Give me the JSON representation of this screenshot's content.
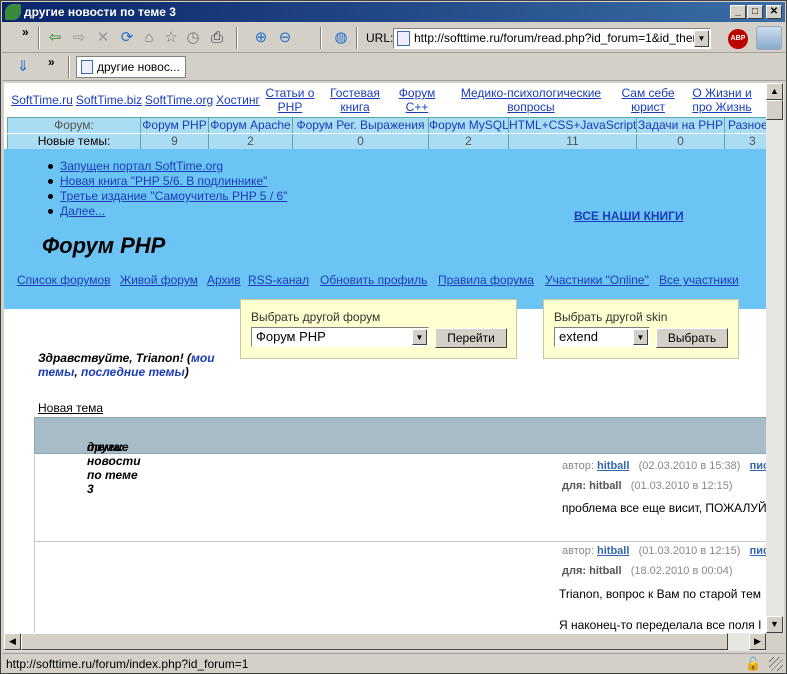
{
  "window": {
    "title": "другие новости по теме 3"
  },
  "toolbar": {
    "url_label": "URL:",
    "url": "http://softtime.ru/forum/read.php?id_forum=1&id_theme=",
    "tab_title": "другие новос..."
  },
  "top_links": [
    {
      "lines": [
        "SoftTime.ru"
      ]
    },
    {
      "lines": [
        "SoftTime.biz"
      ]
    },
    {
      "lines": [
        "SoftTime.org"
      ]
    },
    {
      "lines": [
        "Хостинг"
      ]
    },
    {
      "lines": [
        "Статьи о",
        "PHP"
      ]
    },
    {
      "lines": [
        "Гостевая",
        "книга"
      ]
    },
    {
      "lines": [
        "Форум",
        "C++"
      ]
    },
    {
      "lines": [
        "Медико-психологические",
        "вопросы"
      ]
    },
    {
      "lines": [
        "Сам себе",
        "юрист"
      ]
    },
    {
      "lines": [
        "О Жизни и",
        "про Жизнь"
      ]
    }
  ],
  "forum_table": {
    "row1_label": "Форум:",
    "row2_label": "Новые темы:",
    "forums": [
      {
        "name": "Форум PHP",
        "count": "9"
      },
      {
        "name": "Форум Apache",
        "count": "2"
      },
      {
        "name": "Форум Рег. Выражения",
        "count": "0"
      },
      {
        "name": "Форум MySQL",
        "count": "2"
      },
      {
        "name": "HTML+CSS+JavaScript",
        "count": "11"
      },
      {
        "name": "Задачи на PHP",
        "count": "0"
      },
      {
        "name": "Разное",
        "count": "3"
      }
    ]
  },
  "news": [
    "Запущен портал SoftTime.org",
    "Новая книга \"PHP 5/6. В подлиннике\"",
    "Третье издание \"Самоучитель PHP 5 / 6\"",
    "Далее..."
  ],
  "books_link": "ВСЕ НАШИ КНИГИ",
  "forum_title": "Форум PHP",
  "nav_links": [
    "Список форумов",
    "Живой форум",
    "Архив",
    "RSS-канал",
    "Обновить профиль",
    "Правила форума",
    "Участники \"Online\"",
    "Все участники"
  ],
  "forum_select": {
    "label": "Выбрать другой форум",
    "value": "Форум PHP",
    "button": "Перейти"
  },
  "skin_select": {
    "label": "Выбрать другой skin",
    "value": "extend",
    "button": "Выбрать"
  },
  "greeting": {
    "hello": "Здравствуйте, Trianon!",
    "my": "мои",
    "themes": "темы",
    "last": "последние темы"
  },
  "new_topic": "Новая тема",
  "topic": {
    "prefix": "тема:",
    "title": "другие новости по теме 3"
  },
  "posts": [
    {
      "author_label": "автор:",
      "author": "hitball",
      "date": "(02.03.2010 в 15:38)",
      "action": "пис",
      "for_label": "для:",
      "for": "hitball",
      "for_date": "(01.03.2010 в 12:15)",
      "lines": [
        "проблема все еще висит, ПОЖАЛУЙ"
      ]
    },
    {
      "author_label": "автор:",
      "author": "hitball",
      "date": "(01.03.2010 в 12:15)",
      "action": "пис",
      "for_label": "для:",
      "for": "hitball",
      "for_date": "(18.02.2010 в 00:04)",
      "lines": [
        "Trianon, вопрос к Вам по старой тем",
        "Я наконец-то переделала все поля I"
      ]
    }
  ],
  "status": {
    "text": "http://softtime.ru/forum/index.php?id_forum=1"
  }
}
